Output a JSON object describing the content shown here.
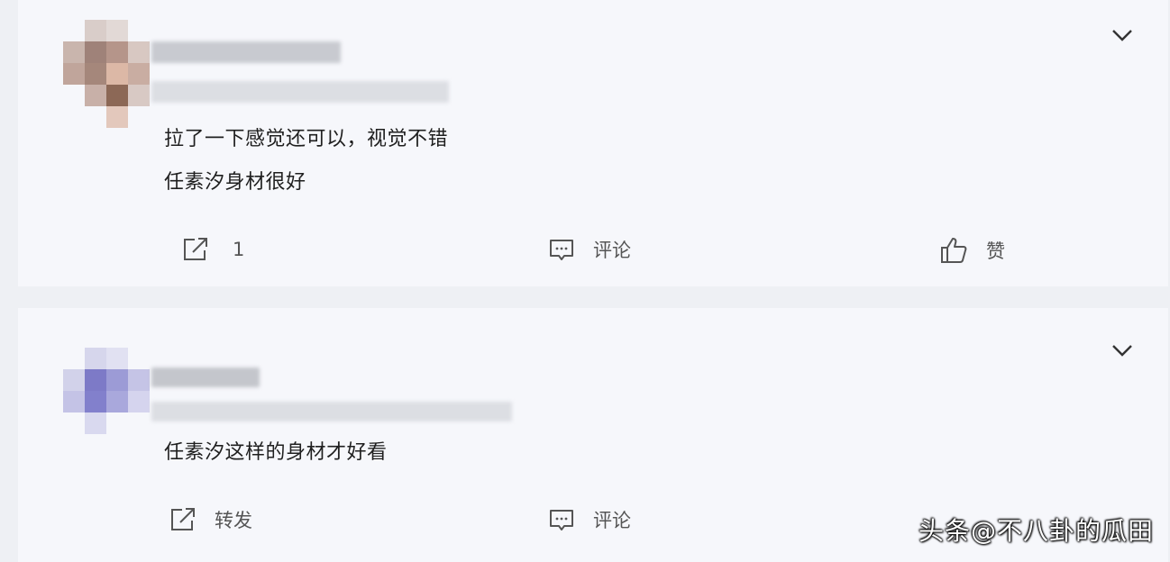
{
  "comments": [
    {
      "lines": [
        "拉了一下感觉还可以，视觉不错",
        "任素汐身材很好"
      ],
      "actions": {
        "share_count": "1",
        "comment_label": "评论",
        "like_label": "赞"
      }
    },
    {
      "lines": [
        "任素汐这样的身材才好看"
      ],
      "actions": {
        "share_label": "转发",
        "comment_label": "评论"
      }
    }
  ],
  "watermark": "头条@不八卦的瓜田",
  "icons": [
    "share-icon",
    "comment-icon",
    "like-icon",
    "chevron-down-icon"
  ]
}
